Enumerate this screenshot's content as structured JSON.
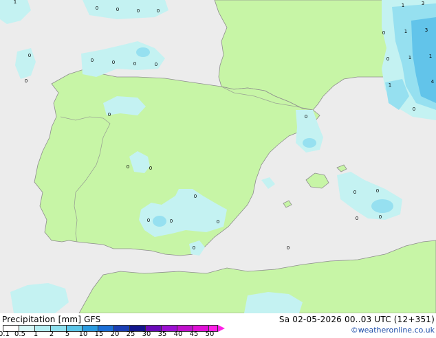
{
  "map": {
    "title": "Precipitation [mm] GFS",
    "datetime": "Sa 02-05-2026 00..03 UTC (12+351)",
    "credit": "©weatheronline.co.uk",
    "colors": {
      "sea": "#ececec",
      "land": "#c7f5a6",
      "border": "#9aa394",
      "coast": "#8d8d8d",
      "precip_light": "#c4f2f2",
      "precip_medium": "#96e0f0",
      "precip_heavy": "#62c4ea"
    },
    "legend": {
      "ticks": [
        "0.1",
        "0.5",
        "1",
        "2",
        "5",
        "10",
        "15",
        "20",
        "25",
        "30",
        "35",
        "40",
        "45",
        "50"
      ],
      "colors": [
        "#ffffff",
        "#d6f7f7",
        "#b4eef2",
        "#8ee0ee",
        "#5cc6e8",
        "#2a9be0",
        "#1c6fd6",
        "#1b3fb4",
        "#12168c",
        "#6a0ab8",
        "#9c10d2",
        "#c010cc",
        "#e010d6",
        "#ff20e6"
      ]
    },
    "value_labels": [
      "1",
      "3",
      "1",
      "3",
      "1",
      "1",
      "1",
      "4",
      "1",
      "0",
      "0",
      "0",
      "0",
      "0",
      "0",
      "0",
      "0",
      "0",
      "0",
      "0",
      "0",
      "0",
      "0",
      "0",
      "0",
      "0",
      "0",
      "0",
      "0",
      "0",
      "0",
      "0",
      "0",
      "0",
      "0",
      "0"
    ]
  }
}
